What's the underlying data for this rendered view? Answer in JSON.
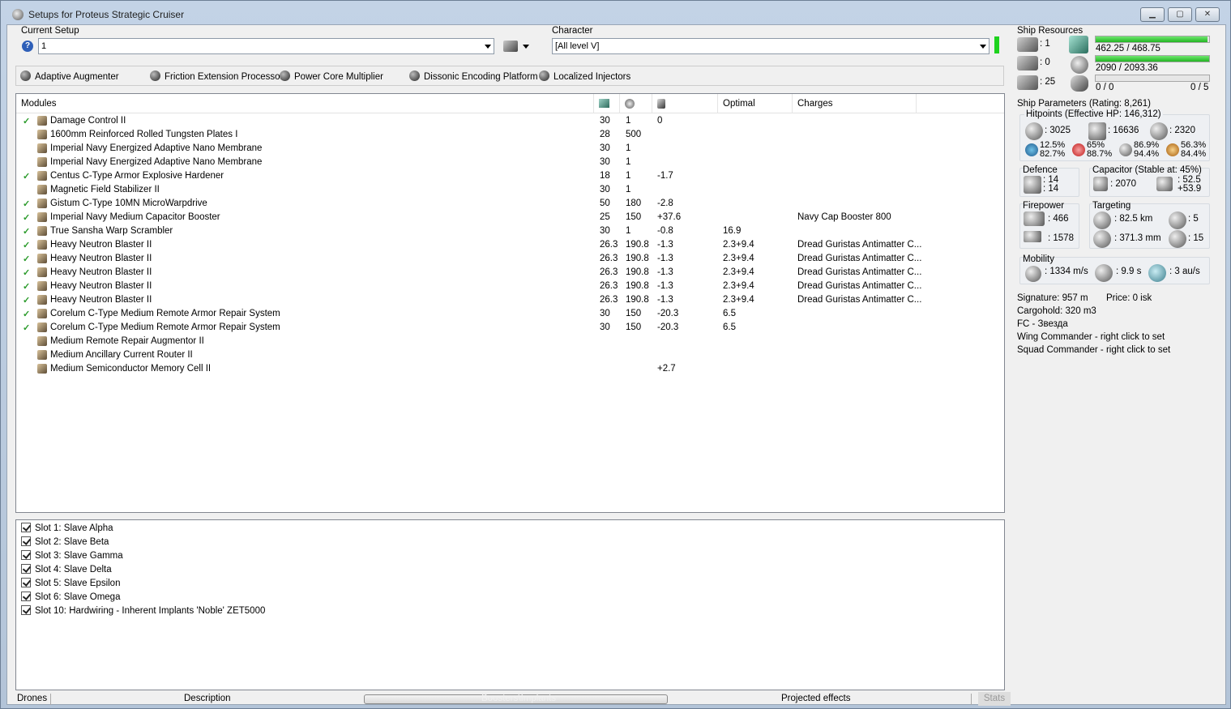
{
  "window": {
    "title": "Setups for Proteus Strategic Cruiser",
    "controls": [
      "minimize",
      "maximize",
      "close"
    ]
  },
  "current_setup": {
    "label": "Current Setup",
    "value": "1"
  },
  "character": {
    "label": "Character",
    "value": "[All level V]"
  },
  "subsystems": [
    "Adaptive Augmenter",
    "Friction Extension Processor",
    "Power Core Multiplier",
    "Dissonic Encoding Platform",
    "Localized Injectors"
  ],
  "modules": {
    "headers": {
      "name": "Modules",
      "cpu_icon": "cpu-icon",
      "pg_icon": "powergrid-icon",
      "cap_icon": "capacitor-icon",
      "optimal": "Optimal",
      "charges": "Charges"
    },
    "rows": [
      {
        "checked": true,
        "name": "Damage Control II",
        "cpu": "30",
        "pg": "1",
        "cap": "0",
        "optimal": "",
        "charge": ""
      },
      {
        "checked": false,
        "name": "1600mm Reinforced Rolled Tungsten Plates I",
        "cpu": "28",
        "pg": "500",
        "cap": "",
        "optimal": "",
        "charge": ""
      },
      {
        "checked": false,
        "name": "Imperial Navy Energized Adaptive Nano Membrane",
        "cpu": "30",
        "pg": "1",
        "cap": "",
        "optimal": "",
        "charge": ""
      },
      {
        "checked": false,
        "name": "Imperial Navy Energized Adaptive Nano Membrane",
        "cpu": "30",
        "pg": "1",
        "cap": "",
        "optimal": "",
        "charge": ""
      },
      {
        "checked": true,
        "name": "Centus C-Type Armor Explosive Hardener",
        "cpu": "18",
        "pg": "1",
        "cap": "-1.7",
        "optimal": "",
        "charge": ""
      },
      {
        "checked": false,
        "name": "Magnetic Field Stabilizer II",
        "cpu": "30",
        "pg": "1",
        "cap": "",
        "optimal": "",
        "charge": ""
      },
      {
        "checked": true,
        "name": "Gistum C-Type 10MN MicroWarpdrive",
        "cpu": "50",
        "pg": "180",
        "cap": "-2.8",
        "optimal": "",
        "charge": ""
      },
      {
        "checked": true,
        "name": "Imperial Navy Medium Capacitor Booster",
        "cpu": "25",
        "pg": "150",
        "cap": "+37.6",
        "optimal": "",
        "charge": "Navy Cap Booster 800"
      },
      {
        "checked": true,
        "name": "True Sansha Warp Scrambler",
        "cpu": "30",
        "pg": "1",
        "cap": "-0.8",
        "optimal": "16.9",
        "charge": ""
      },
      {
        "checked": true,
        "name": "Heavy Neutron Blaster II",
        "cpu": "26.3",
        "pg": "190.8",
        "cap": "-1.3",
        "optimal": "2.3+9.4",
        "charge": "Dread Guristas Antimatter C..."
      },
      {
        "checked": true,
        "name": "Heavy Neutron Blaster II",
        "cpu": "26.3",
        "pg": "190.8",
        "cap": "-1.3",
        "optimal": "2.3+9.4",
        "charge": "Dread Guristas Antimatter C..."
      },
      {
        "checked": true,
        "name": "Heavy Neutron Blaster II",
        "cpu": "26.3",
        "pg": "190.8",
        "cap": "-1.3",
        "optimal": "2.3+9.4",
        "charge": "Dread Guristas Antimatter C..."
      },
      {
        "checked": true,
        "name": "Heavy Neutron Blaster II",
        "cpu": "26.3",
        "pg": "190.8",
        "cap": "-1.3",
        "optimal": "2.3+9.4",
        "charge": "Dread Guristas Antimatter C..."
      },
      {
        "checked": true,
        "name": "Heavy Neutron Blaster II",
        "cpu": "26.3",
        "pg": "190.8",
        "cap": "-1.3",
        "optimal": "2.3+9.4",
        "charge": "Dread Guristas Antimatter C..."
      },
      {
        "checked": true,
        "name": "Corelum C-Type Medium Remote Armor Repair System",
        "cpu": "30",
        "pg": "150",
        "cap": "-20.3",
        "optimal": "6.5",
        "charge": ""
      },
      {
        "checked": true,
        "name": "Corelum C-Type Medium Remote Armor Repair System",
        "cpu": "30",
        "pg": "150",
        "cap": "-20.3",
        "optimal": "6.5",
        "charge": ""
      },
      {
        "checked": false,
        "name": "Medium Remote Repair Augmentor II",
        "cpu": "",
        "pg": "",
        "cap": "",
        "optimal": "",
        "charge": ""
      },
      {
        "checked": false,
        "name": "Medium Ancillary Current Router II",
        "cpu": "",
        "pg": "",
        "cap": "",
        "optimal": "",
        "charge": ""
      },
      {
        "checked": false,
        "name": "Medium Semiconductor Memory Cell II",
        "cpu": "",
        "pg": "",
        "cap": "+2.7",
        "optimal": "",
        "charge": ""
      }
    ]
  },
  "implants": [
    "Slot 1: Slave Alpha",
    "Slot 2: Slave Beta",
    "Slot 3: Slave Gamma",
    "Slot 4: Slave Delta",
    "Slot 5: Slave Epsilon",
    "Slot 6: Slave Omega",
    "Slot 10: Hardwiring - Inherent Implants 'Noble' ZET5000"
  ],
  "bottom_tabs": {
    "drones": "Drones",
    "description": "Description",
    "boosters": "Boosters\\Implants",
    "projected": "Projected effects",
    "stats": "Stats"
  },
  "ship_resources": {
    "label": "Ship Resources",
    "turret_slots": ": 1",
    "launcher_slots": ": 0",
    "calibration": ": 25",
    "cpu": "462.25 / 468.75",
    "cpu_fraction": 0.986,
    "powergrid": "2090 / 2093.36",
    "powergrid_fraction": 0.998,
    "drone_bay": "0 / 0",
    "drones": "0 / 5",
    "drone_fraction": 0
  },
  "ship_parameters": {
    "label": "Ship Parameters (Rating: 8,261)",
    "hitpoints_label": "Hitpoints (Effective HP: 146,312)",
    "shield": ": 3025",
    "armor": ": 16636",
    "structure": ": 2320",
    "em": "12.5%",
    "em2": "82.7%",
    "thermal": "65%",
    "thermal2": "88.7%",
    "kinetic": "86.9%",
    "kinetic2": "94.4%",
    "explosive": "56.3%",
    "explosive2": "84.4%",
    "defence_label": "Defence",
    "defence1": ": 14",
    "defence2": ": 14",
    "capacitor_label": "Capacitor (Stable at: 45%)",
    "cap_amount": ": 2070",
    "cap_rate1": ": 52.5",
    "cap_rate2": "+53.9",
    "firepower_label": "Firepower",
    "dps": ": 466",
    "volley": ": 1578",
    "targeting_label": "Targeting",
    "range": ": 82.5 km",
    "targets": ": 5",
    "scan_res": ": 371.3 mm",
    "sensor": ": 15",
    "mobility_label": "Mobility",
    "velocity": ": 1334 m/s",
    "align": ": 9.9 s",
    "warp": ": 3 au/s",
    "signature": "Signature: 957 m",
    "price": "Price: 0 isk",
    "cargohold": "Cargohold: 320 m3",
    "fc": "FC - Звезда",
    "wing": "Wing Commander - right click to set",
    "squad": "Squad Commander - right click to set"
  }
}
